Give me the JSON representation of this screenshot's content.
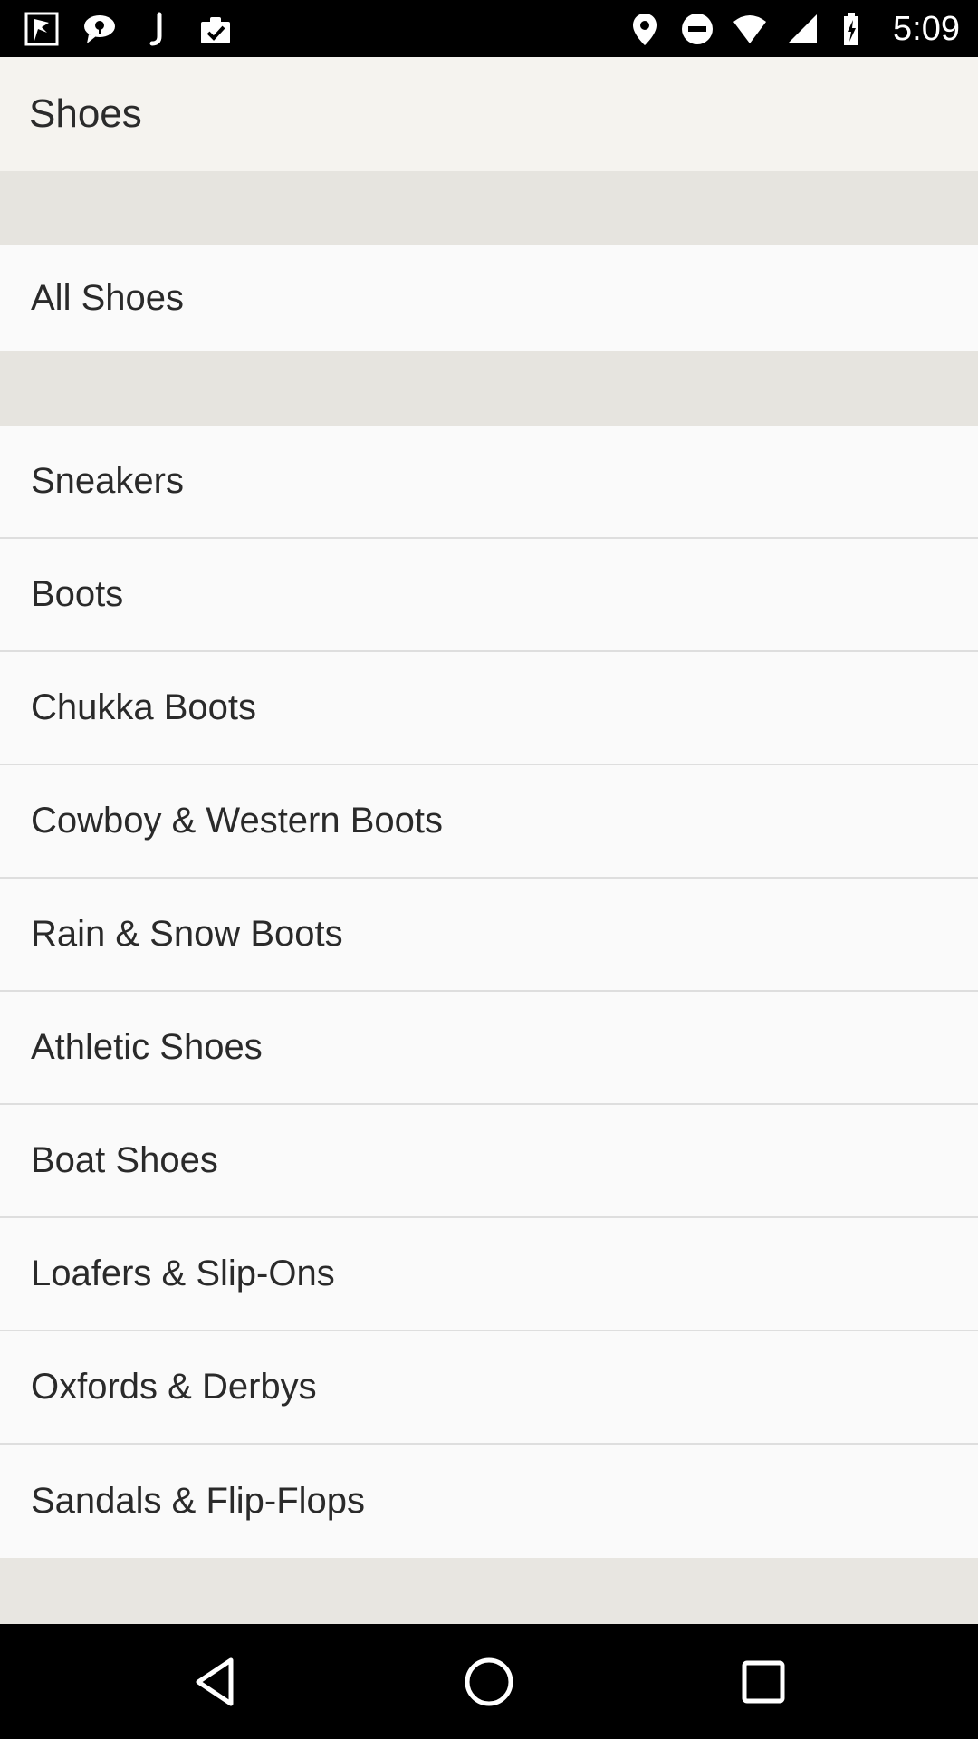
{
  "status_bar": {
    "time": "5:09",
    "left_icons": [
      "flag-notification-icon",
      "chat-bubble-icon",
      "j-app-icon",
      "clipboard-check-icon"
    ],
    "right_icons": [
      "location-pin-icon",
      "do-not-disturb-icon",
      "wifi-icon",
      "cell-signal-icon",
      "battery-charging-icon"
    ]
  },
  "app_bar": {
    "title": "Shoes"
  },
  "all_section": {
    "label": "All Shoes"
  },
  "categories": [
    "Sneakers",
    "Boots",
    "Chukka Boots",
    "Cowboy & Western Boots",
    "Rain & Snow Boots",
    "Athletic Shoes",
    "Boat Shoes",
    "Loafers & Slip-Ons",
    "Oxfords & Derbys",
    "Sandals & Flip-Flops"
  ],
  "nav_bar": {
    "buttons": [
      "back-icon",
      "home-icon",
      "recents-icon"
    ]
  },
  "colors": {
    "status_bar": "#000000",
    "app_bar": "#f5f3ef",
    "section_gap": "#e6e4df",
    "list_background": "#fafafa",
    "text": "#2a2a2a"
  }
}
